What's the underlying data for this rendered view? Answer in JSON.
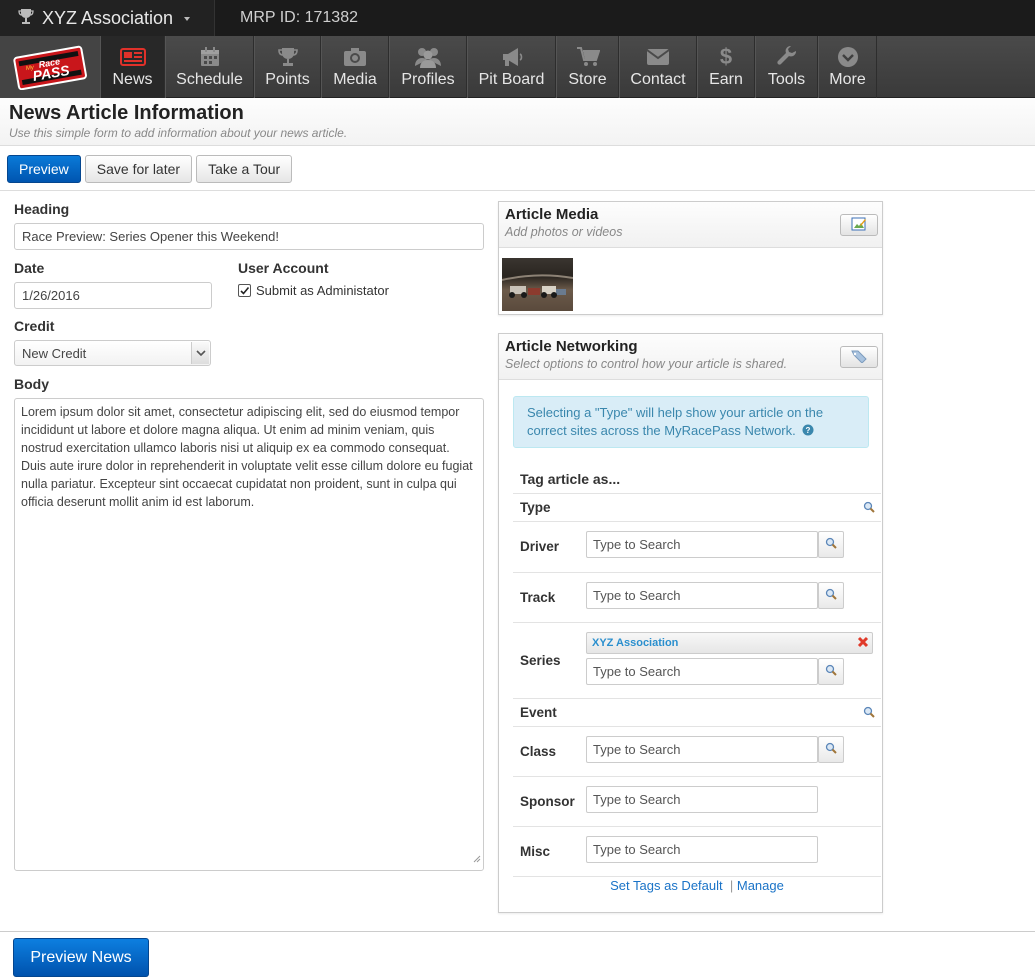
{
  "topbar": {
    "org_name": "XYZ Association",
    "mrp_id": "MRP ID: 171382"
  },
  "logo": {
    "line1": "My",
    "line2": "Race",
    "line3": "PASS"
  },
  "nav": {
    "items": [
      {
        "label": "News",
        "icon": "newspaper-icon",
        "active": true
      },
      {
        "label": "Schedule",
        "icon": "calendar-icon"
      },
      {
        "label": "Points",
        "icon": "trophy-icon"
      },
      {
        "label": "Media",
        "icon": "camera-icon"
      },
      {
        "label": "Profiles",
        "icon": "people-icon"
      },
      {
        "label": "Pit Board",
        "icon": "megaphone-icon"
      },
      {
        "label": "Store",
        "icon": "cart-icon"
      },
      {
        "label": "Contact",
        "icon": "envelope-icon"
      },
      {
        "label": "Earn",
        "icon": "dollar-icon"
      },
      {
        "label": "Tools",
        "icon": "wrench-icon"
      },
      {
        "label": "More",
        "icon": "chevron-circle-icon"
      }
    ]
  },
  "page": {
    "title": "News Article Information",
    "subtitle": "Use this simple form to add information about your news article."
  },
  "toolbar": {
    "preview": "Preview",
    "save_later": "Save for later",
    "tour": "Take a Tour"
  },
  "form": {
    "heading_label": "Heading",
    "heading_value": "Race Preview: Series Opener this Weekend!",
    "date_label": "Date",
    "date_value": "1/26/2016",
    "account_label": "User Account",
    "account_checkbox": "Submit as Administator",
    "credit_label": "Credit",
    "credit_value": "New Credit",
    "body_label": "Body",
    "body_value": "Lorem ipsum dolor sit amet, consectetur adipiscing elit, sed do eiusmod tempor incididunt ut labore et dolore magna aliqua. Ut enim ad minim veniam, quis nostrud exercitation ullamco laboris nisi ut aliquip ex ea commodo consequat. Duis aute irure dolor in reprehenderit in voluptate velit esse cillum dolore eu fugiat nulla pariatur. Excepteur sint occaecat cupidatat non proident, sunt in culpa qui officia deserunt mollit anim id est laborum."
  },
  "media": {
    "title": "Article Media",
    "subtitle": "Add photos or videos"
  },
  "networking": {
    "title": "Article Networking",
    "subtitle": "Select options to control how your article is shared.",
    "info": "Selecting a \"Type\" will help show your article on the correct sites across the MyRacePass Network.",
    "tag_heading": "Tag article as...",
    "placeholder": "Type to Search",
    "rows": {
      "type": "Type",
      "driver": "Driver",
      "track": "Track",
      "series": "Series",
      "event": "Event",
      "class": "Class",
      "sponsor": "Sponsor",
      "misc": "Misc"
    },
    "series_tag": "XYZ Association",
    "set_default": "Set Tags as Default",
    "separator": "|",
    "manage": "Manage"
  },
  "footer": {
    "preview_news": "Preview News"
  },
  "colors": {
    "primary": "#0a6ccf",
    "info_bg": "#d9edf7",
    "link": "#1a73c7",
    "accent_red": "#e03a2a"
  }
}
